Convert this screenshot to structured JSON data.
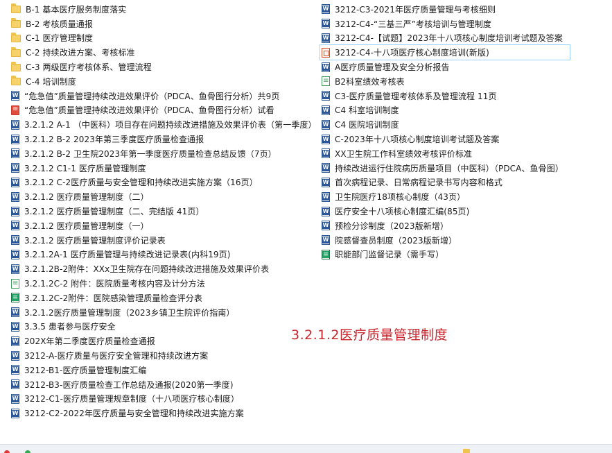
{
  "left_column": [
    {
      "type": "folder",
      "label": "B-1    基本医疗服务制度落实"
    },
    {
      "type": "folder",
      "label": "B-2    考核质量通报"
    },
    {
      "type": "folder",
      "label": "C-1    医疗管理制度"
    },
    {
      "type": "folder",
      "label": "C-2    持续改进方案、考核标准"
    },
    {
      "type": "folder",
      "label": "C-3    两级医疗考核体系、管理流程"
    },
    {
      "type": "folder",
      "label": "C-4    培训制度"
    },
    {
      "type": "word",
      "label": "“危急值”质量管理持续改进效果评价（PDCA、鱼骨图行分析）共9页"
    },
    {
      "type": "pdf",
      "label": "“危急值”质量管理持续改进效果评价（PDCA、鱼骨图行分析）试看"
    },
    {
      "type": "word",
      "label": "3.2.1.2 A-1 （中医科）项目存在问题持续改进措施及效果评价表（第一季度）"
    },
    {
      "type": "word",
      "label": "3.2.1.2 B-2 2023年第三季度医疗质量检查通报"
    },
    {
      "type": "word",
      "label": "3.2.1.2 B-2 卫生院2023年第一季度医疗质量检查总结反馈（7页）"
    },
    {
      "type": "word",
      "label": "3.2.1.2 C1-1 医疗质量管理制度"
    },
    {
      "type": "word",
      "label": "3.2.1.2 C-2医疗质量与安全管理和持续改进实施方案（16页）"
    },
    {
      "type": "word",
      "label": "3.2.1.2 医疗质量管理制度（二）"
    },
    {
      "type": "word",
      "label": "3.2.1.2 医疗质量管理制度（二、完结版  41页）"
    },
    {
      "type": "word",
      "label": "3.2.1.2 医疗质量管理制度（一）"
    },
    {
      "type": "word",
      "label": "3.2.1.2 医疗质量管理制度评价记录表"
    },
    {
      "type": "word",
      "label": "3.2.1.2A-1 医疗质量管理与持续改进记录表(内科19页)"
    },
    {
      "type": "word",
      "label": "3.2.1.2B-2附件：XXx卫生院存在问题持续改进措施及效果评价表"
    },
    {
      "type": "wps",
      "label": "3.2.1.2C-2 附件：医院质量考核内容及计分方法"
    },
    {
      "type": "excel",
      "label": "3.2.1.2C-2附件：医院感染管理质量检查评分表"
    },
    {
      "type": "word",
      "label": "3.2.1.2医疗质量管理制度（2023乡镇卫生院评价指南）"
    },
    {
      "type": "word",
      "label": "3.3.5 患者参与医疗安全"
    },
    {
      "type": "word",
      "label": "202X年第二季度医疗质量检查通报"
    },
    {
      "type": "word",
      "label": "3212-A-医疗质量与医疗安全管理和持续改进方案"
    },
    {
      "type": "word",
      "label": "3212-B1-医疗质量管理制度汇编"
    },
    {
      "type": "word",
      "label": "3212-B3-医疗质量检查工作总结及通报(2020第一季度)"
    },
    {
      "type": "word",
      "label": "3212-C1-医疗质量管理规章制度（十八项医疗核心制度）"
    },
    {
      "type": "word",
      "label": "3212-C2-2022年医疗质量与安全管理和持续改进实施方案"
    }
  ],
  "right_column": [
    {
      "type": "word",
      "label": "3212-C3-2021年医疗质量管理与考核细则"
    },
    {
      "type": "word",
      "label": "3212-C4-“三基三严”考核培训与管理制度"
    },
    {
      "type": "word",
      "label": "3212-C4-【试题】2023年十八项核心制度培训考试题及答案"
    },
    {
      "type": "ppt",
      "label": "3212-C4-十八项医疗核心制度培训(新版)",
      "selected": true
    },
    {
      "type": "word",
      "label": "A医疗质量管理及安全分析报告"
    },
    {
      "type": "wps",
      "label": "B2科室绩效考核表"
    },
    {
      "type": "word",
      "label": "C3-医疗质量管理考核体系及管理流程   11页"
    },
    {
      "type": "word",
      "label": "C4 科室培训制度"
    },
    {
      "type": "word",
      "label": "C4 医院培训制度"
    },
    {
      "type": "word",
      "label": "C-2023年十八项核心制度培训考试题及答案"
    },
    {
      "type": "word",
      "label": "XX卫生院工作科室绩效考核评价标准"
    },
    {
      "type": "word",
      "label": "持续改进运行住院病历质量项目（中医科）（PDCA、鱼骨图）"
    },
    {
      "type": "word",
      "label": "首次病程记录、日常病程记录书写内容和格式"
    },
    {
      "type": "word",
      "label": "卫生院医疗18项核心制度（43页）"
    },
    {
      "type": "word",
      "label": "医疗安全十八项核心制度汇编(85页)"
    },
    {
      "type": "word",
      "label": "预检分诊制度（2023版新增）"
    },
    {
      "type": "word",
      "label": "院感督查员制度（2023版新增）"
    },
    {
      "type": "excel",
      "label": "职能部门监督记录（需手写）"
    }
  ],
  "overlay_title": "3.2.1.2医疗质量管理制度",
  "colors": {
    "overlay": "#c8262d",
    "selection": "#99d1ff",
    "folder": "#f7d26b",
    "word": "#2b579a",
    "excel": "#21a366"
  }
}
